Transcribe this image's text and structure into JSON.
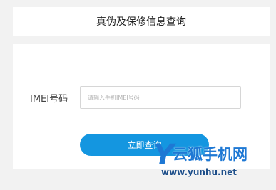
{
  "header": {
    "title": "真伪及保修信息查询"
  },
  "form": {
    "imei_label": "IMEI号码",
    "imei_placeholder": "请输入手机IMEI号码",
    "submit_label": "立即查询"
  },
  "watermark": {
    "logo_letter": "Y",
    "site_name": "云狐手机网",
    "url": "www.yunhu.net"
  },
  "colors": {
    "accent": "#1496e0",
    "watermark": "#1e78d4",
    "background": "#f2f2f2"
  }
}
